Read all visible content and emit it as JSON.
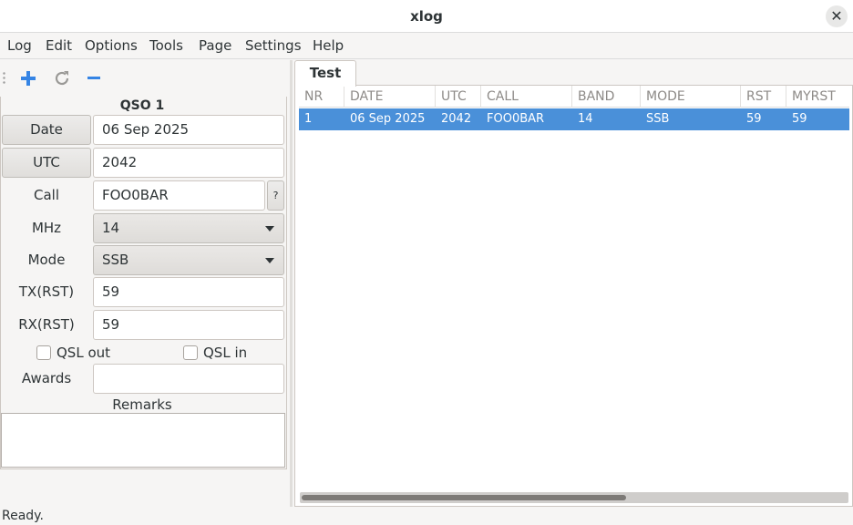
{
  "window": {
    "title": "xlog"
  },
  "menu": {
    "items": [
      "Log",
      "Edit",
      "Options",
      "Tools",
      "Page",
      "Settings",
      "Help"
    ]
  },
  "toolbar": {
    "add_icon": "plus-icon",
    "refresh_icon": "refresh-icon",
    "remove_icon": "minus-icon"
  },
  "qso": {
    "title": "QSO 1",
    "date_label": "Date",
    "date_value": "06 Sep 2025",
    "utc_label": "UTC",
    "utc_value": "2042",
    "call_label": "Call",
    "call_value": "FOO0BAR",
    "call_button": "?",
    "mhz_label": "MHz",
    "mhz_value": "14",
    "mode_label": "Mode",
    "mode_value": "SSB",
    "tx_label": "TX(RST)",
    "tx_value": "59",
    "rx_label": "RX(RST)",
    "rx_value": "59",
    "qsl_out_label": "QSL out",
    "qsl_in_label": "QSL in",
    "awards_label": "Awards",
    "awards_value": "",
    "remarks_label": "Remarks",
    "remarks_value": ""
  },
  "log": {
    "tab": "Test",
    "columns": [
      "NR",
      "DATE",
      "UTC",
      "CALL",
      "BAND",
      "MODE",
      "RST",
      "MYRST"
    ],
    "rows": [
      [
        "1",
        "06 Sep 2025",
        "2042",
        "FOO0BAR",
        "14",
        "SSB",
        "59",
        "59"
      ]
    ]
  },
  "status": {
    "text": "Ready."
  },
  "colors": {
    "selection": "#4a90d9",
    "background": "#f6f5f4",
    "icon_blue": "#3584e4"
  }
}
